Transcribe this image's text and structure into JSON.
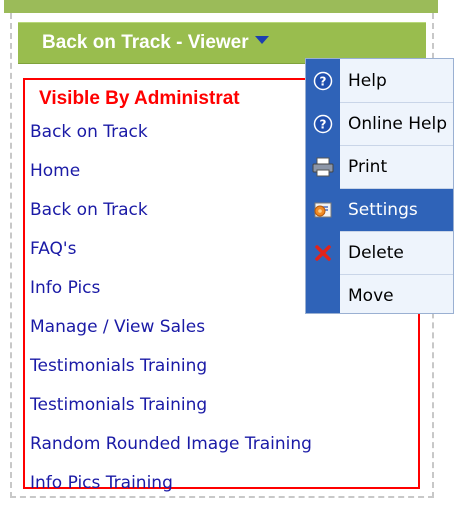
{
  "panel": {
    "title": "Back on Track - Viewer",
    "visibility_title": "Visible By Administrat",
    "links": [
      "Back on Track",
      "Home",
      "Back on Track",
      "FAQ's",
      "Info Pics",
      "Manage / View Sales",
      "Testimonials Training",
      "Testimonials Training",
      "Random Rounded Image Training",
      "Info Pics Training"
    ]
  },
  "context_menu": {
    "items": [
      {
        "label": "Help",
        "icon": "help-icon"
      },
      {
        "label": "Online Help",
        "icon": "online-help-icon"
      },
      {
        "label": "Print",
        "icon": "printer-icon"
      },
      {
        "label": "Settings",
        "icon": "settings-icon",
        "selected": true
      },
      {
        "label": "Delete",
        "icon": "delete-icon"
      },
      {
        "label": "Move",
        "icon": ""
      }
    ]
  },
  "colors": {
    "header_green": "#99bd4e",
    "link_blue": "#1a1aa6",
    "admin_red": "#ff0000",
    "menu_selected": "#2f63b8"
  }
}
